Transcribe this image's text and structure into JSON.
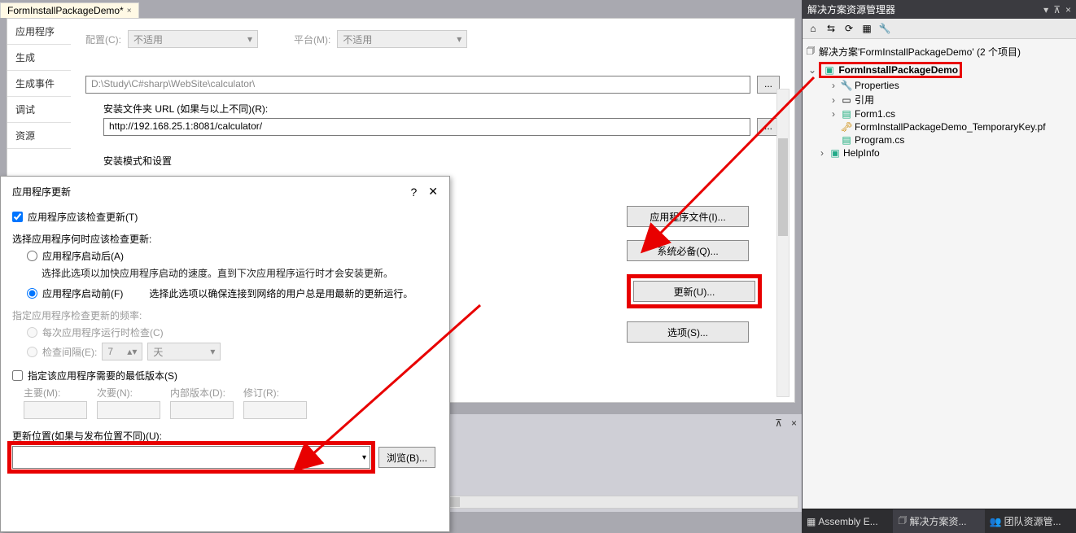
{
  "tab": {
    "title": "FormInstallPackageDemo*",
    "close": "×"
  },
  "propsNav": {
    "app": "应用程序",
    "build": "生成",
    "buildEvent": "生成事件",
    "debug": "调试",
    "resource": "资源"
  },
  "config": {
    "label": "配置(C):",
    "value": "不适用",
    "platformLabel": "平台(M):",
    "platformValue": "不适用"
  },
  "pathValue": "D:\\Study\\C#sharp\\WebSite\\calculator\\",
  "urlLabel": "安装文件夹 URL (如果与以上不同)(R):",
  "urlValue": "http://192.168.25.1:8081/calculator/",
  "installMode": "安装模式和设置",
  "btns": {
    "files": "应用程序文件(I)...",
    "prereq": "系统必备(Q)...",
    "update": "更新(U)...",
    "options": "选项(S)..."
  },
  "dialog": {
    "title": "应用程序更新",
    "check": "应用程序应该检查更新(T)",
    "whenLabel": "选择应用程序何时应该检查更新:",
    "afterStart": "应用程序启动后(A)",
    "afterHint": "选择此选项以加快应用程序启动的速度。直到下次应用程序运行时才会安装更新。",
    "beforeStart": "应用程序启动前(F)",
    "beforeHint": "选择此选项以确保连接到网络的用户总是用最新的更新运行。",
    "freqLabel": "指定应用程序检查更新的频率:",
    "everyRun": "每次应用程序运行时检查(C)",
    "interval": "检查间隔(E):",
    "intervalVal": "7",
    "intervalUnit": "天",
    "minVersion": "指定该应用程序需要的最低版本(S)",
    "major": "主要(M):",
    "minor": "次要(N):",
    "build": "内部版本(D):",
    "rev": "修订(R):",
    "updlocLabel": "更新位置(如果与发布位置不同)(U):",
    "browse": "浏览(B)..."
  },
  "solex": {
    "title": "解决方案资源管理器",
    "root": "解决方案'FormInstallPackageDemo' (2 个项目)",
    "proj": "FormInstallPackageDemo",
    "properties": "Properties",
    "refs": "引用",
    "form1": "Form1.cs",
    "key": "FormInstallPackageDemo_TemporaryKey.pf",
    "program": "Program.cs",
    "help": "HelpInfo"
  },
  "sideTabs": {
    "asm": "Assembly E...",
    "sol": "解决方案资...",
    "team": "团队资源管..."
  },
  "dots": "..."
}
